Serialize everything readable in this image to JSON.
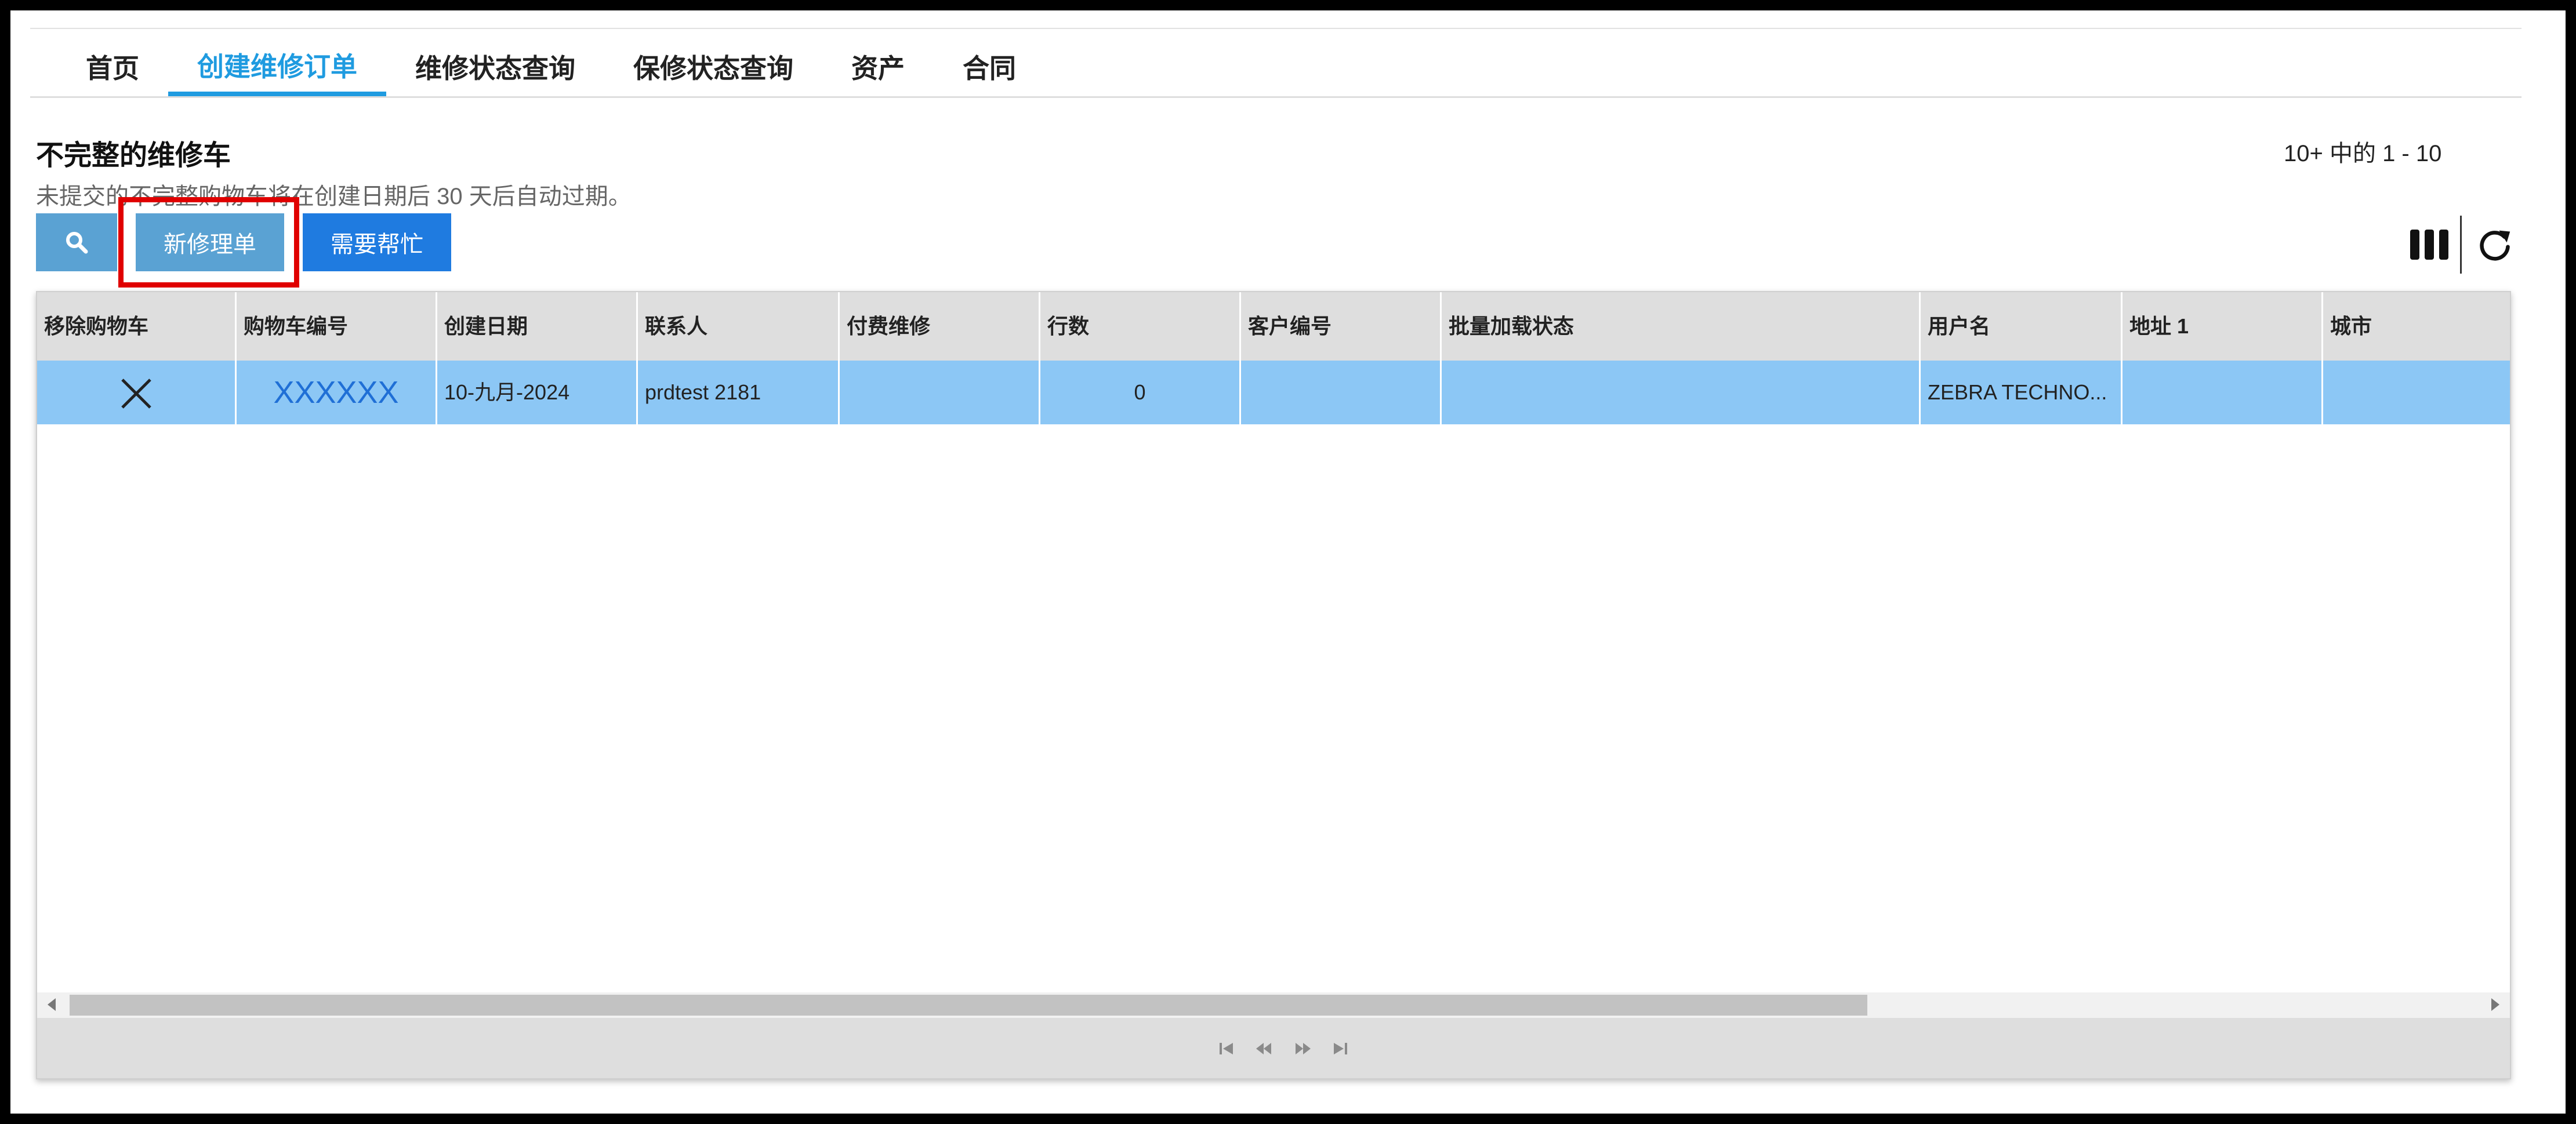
{
  "tabs": [
    {
      "label": "首页",
      "active": false
    },
    {
      "label": "创建维修订单",
      "active": true
    },
    {
      "label": "维修状态查询",
      "active": false
    },
    {
      "label": "保修状态查询",
      "active": false
    },
    {
      "label": "资产",
      "active": false
    },
    {
      "label": "合同",
      "active": false
    }
  ],
  "section": {
    "title": "不完整的维修车",
    "subtitle": "未提交的不完整购物车将在创建日期后 30 天后自动过期。"
  },
  "pager": {
    "count_text": "10+ 中的 1 - 10"
  },
  "toolbar": {
    "search_icon": "search-icon",
    "new_label": "新修理单",
    "help_label": "需要帮忙",
    "columns_icon": "columns-icon",
    "refresh_icon": "refresh-icon"
  },
  "colors": {
    "accent": "#1f9be0",
    "selected_row": "#8cc7f5",
    "highlight": "#e00000"
  },
  "table": {
    "columns": [
      "移除购物车",
      "购物车编号",
      "创建日期",
      "联系人",
      "付费维修",
      "行数",
      "客户编号",
      "批量加载状态",
      "用户名",
      "地址 1",
      "城市"
    ],
    "rows": [
      {
        "remove": "close-icon",
        "cart_no": "XXXXXX",
        "created": "10-九月-2024",
        "contact": "prdtest 2181",
        "paid": "",
        "lines": "0",
        "customer_no": "",
        "bulk_status": "",
        "username": "ZEBRA TECHNO...",
        "address1": "",
        "city": ""
      }
    ]
  }
}
